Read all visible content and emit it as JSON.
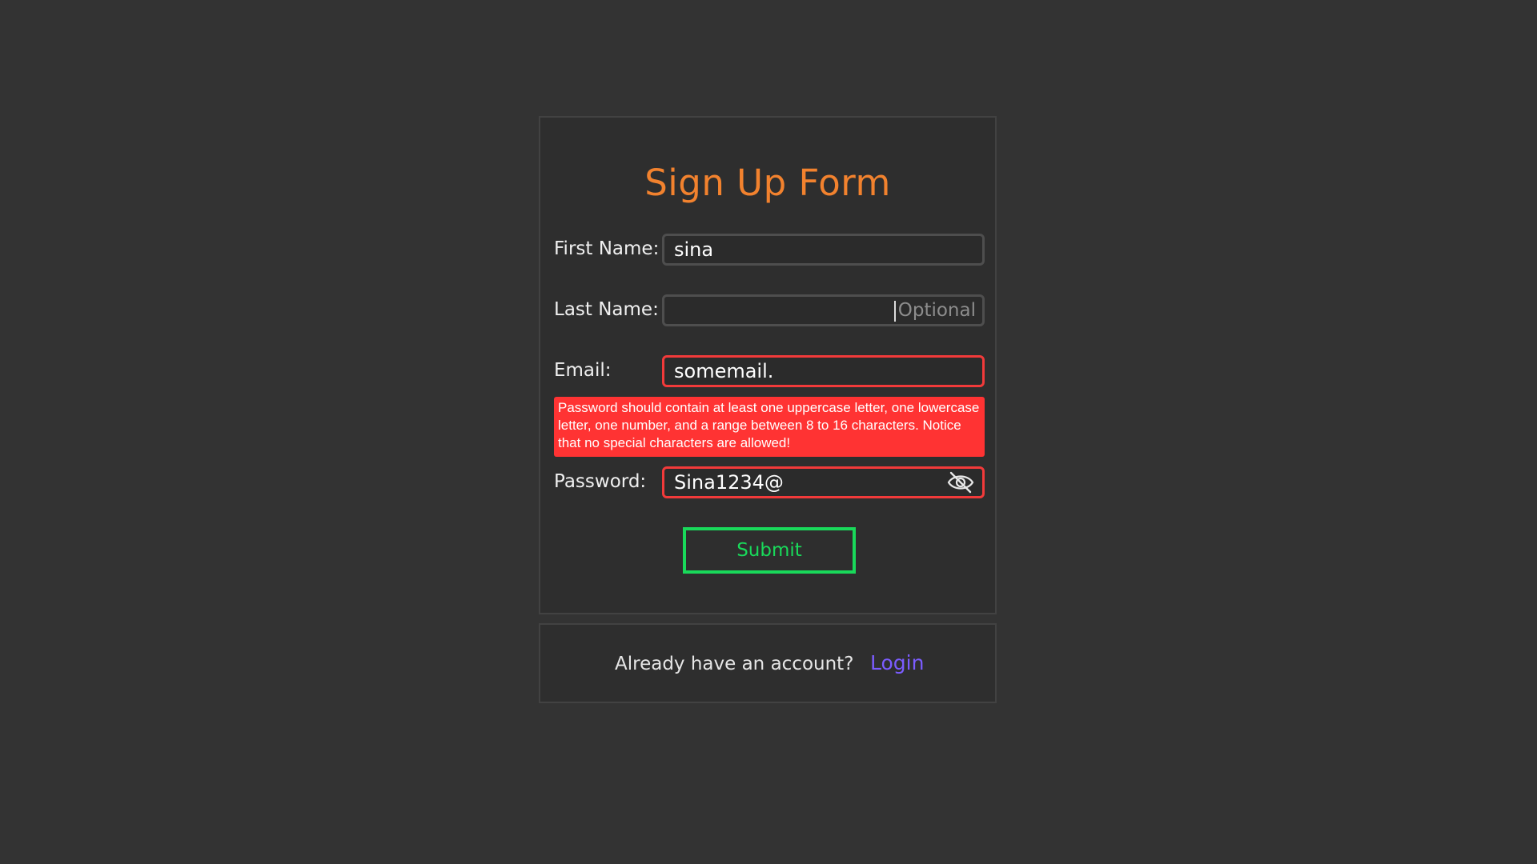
{
  "form": {
    "title": "Sign Up Form",
    "fields": [
      {
        "label": "First Name:",
        "value": "sina",
        "placeholder": ""
      },
      {
        "label": "Last Name:",
        "value": "",
        "placeholder": "Optional"
      },
      {
        "label": "Email:",
        "value": "somemail.",
        "placeholder": ""
      },
      {
        "label": "Password:",
        "value": "Sina1234@",
        "placeholder": ""
      }
    ],
    "password_error": "Password should contain at least one uppercase letter, one lowercase letter, one number, and a range between 8 to 16 characters. Notice that no special characters are allowed!",
    "password_toggle_icon": "eye-slash-icon",
    "submit_label": "Submit"
  },
  "footer": {
    "prompt": "Already have an account?",
    "login_label": "Login"
  },
  "colors": {
    "background": "#333333",
    "title": "#f2822e",
    "error": "#ff3333",
    "submit": "#19d95a",
    "link": "#7b5cff"
  }
}
